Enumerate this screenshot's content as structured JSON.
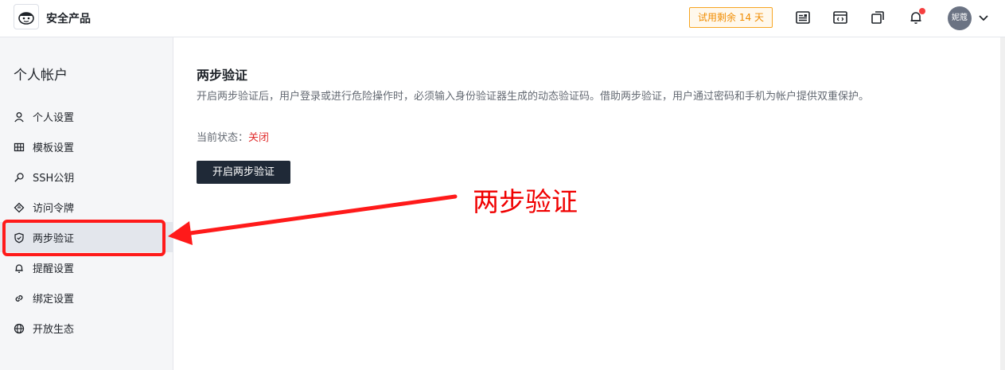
{
  "header": {
    "product_name": "安全产品",
    "trial_badge": "试用剩余 14 天",
    "avatar_text": "妮蔻",
    "icons": [
      "news-icon",
      "code-window-icon",
      "copy-windows-icon",
      "bell-icon",
      "chevron-down-icon"
    ]
  },
  "sidebar": {
    "title": "个人帐户",
    "items": [
      {
        "label": "个人设置",
        "icon": "user-icon"
      },
      {
        "label": "模板设置",
        "icon": "grid-icon"
      },
      {
        "label": "SSH公钥",
        "icon": "key-icon"
      },
      {
        "label": "访问令牌",
        "icon": "ticket-icon"
      },
      {
        "label": "两步验证",
        "icon": "shield-icon",
        "active": true
      },
      {
        "label": "提醒设置",
        "icon": "bell-icon"
      },
      {
        "label": "绑定设置",
        "icon": "link-icon"
      },
      {
        "label": "开放生态",
        "icon": "globe-icon"
      }
    ]
  },
  "main": {
    "title": "两步验证",
    "description": "开启两步验证后，用户登录或进行危险操作时，必须输入身份验证器生成的动态验证码。借助两步验证，用户通过密码和手机为帐户提供双重保护。",
    "status_label": "当前状态：",
    "status_value": "关闭",
    "enable_button": "开启两步验证"
  },
  "annotation": {
    "text": "两步验证",
    "color": "#f00000"
  },
  "colors": {
    "accent_dark": "#1f2937",
    "status_off": "#e12d2d",
    "trial_orange": "#f08c00",
    "annotation_red": "#ff1a1a"
  }
}
